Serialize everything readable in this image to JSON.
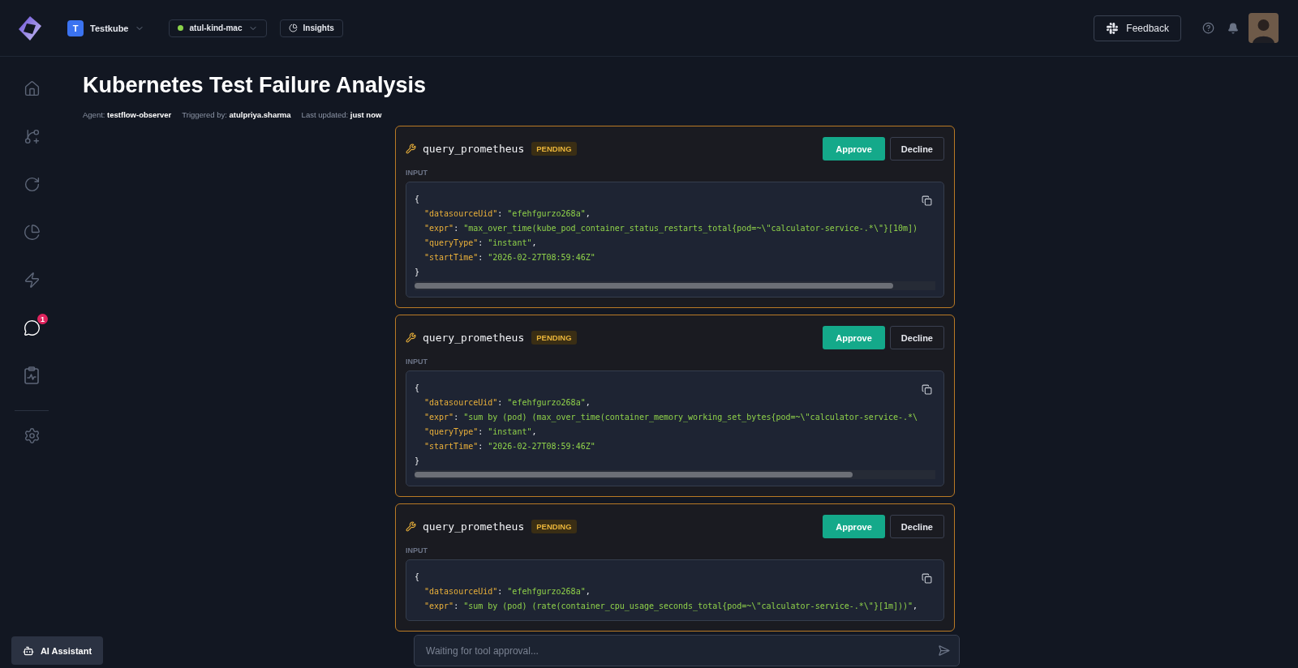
{
  "topbar": {
    "workspace": {
      "initial": "T",
      "name": "Testkube"
    },
    "environment": {
      "name": "atul-kind-mac",
      "color": "#8bd34a"
    },
    "insights": "Insights",
    "feedback": "Feedback"
  },
  "sidebar": {
    "items": [
      {
        "kind": "home",
        "selected": false
      },
      {
        "kind": "workflows",
        "selected": false
      },
      {
        "kind": "runs",
        "selected": false
      },
      {
        "kind": "analytics",
        "selected": false
      },
      {
        "kind": "triggers",
        "selected": false
      },
      {
        "kind": "chats",
        "selected": true,
        "badge": "1"
      },
      {
        "kind": "reports",
        "selected": false
      }
    ],
    "footer_items": [
      {
        "kind": "settings",
        "selected": false
      }
    ],
    "assistant": "AI Assistant"
  },
  "page": {
    "title": "Kubernetes Test Failure Analysis",
    "meta": [
      {
        "label": "Agent:",
        "value": "testflow-observer"
      },
      {
        "label": "Triggered by:",
        "value": "atulpriya.sharma"
      },
      {
        "label": "Last updated:",
        "value": "just now"
      }
    ]
  },
  "tool_calls": [
    {
      "name": "query_prometheus",
      "status": "PENDING",
      "approve": "Approve",
      "decline": "Decline",
      "input_label": "INPUT",
      "open": "{",
      "close": "}",
      "fields": [
        {
          "key": "\"datasourceUid\"",
          "sep": ":",
          "value": "\"efehfgurzo268a\"",
          "end": ","
        },
        {
          "key": "\"expr\"",
          "sep": ":",
          "value": "\"max_over_time(kube_pod_container_status_restarts_total{pod=~\\\"calculator-service-.*\\\"}[10m])"
        },
        {
          "key": "\"queryType\"",
          "sep": ":",
          "value": "\"instant\"",
          "end": ","
        },
        {
          "key": "\"startTime\"",
          "sep": ":",
          "value": "\"2026-02-27T08:59:46Z\""
        }
      ]
    },
    {
      "name": "query_prometheus",
      "status": "PENDING",
      "approve": "Approve",
      "decline": "Decline",
      "input_label": "INPUT",
      "open": "{",
      "close": "}",
      "fields": [
        {
          "key": "\"datasourceUid\"",
          "sep": ":",
          "value": "\"efehfgurzo268a\"",
          "end": ","
        },
        {
          "key": "\"expr\"",
          "sep": ":",
          "value": "\"sum by (pod) (max_over_time(container_memory_working_set_bytes{pod=~\\\"calculator-service-.*\\"
        },
        {
          "key": "\"queryType\"",
          "sep": ":",
          "value": "\"instant\"",
          "end": ","
        },
        {
          "key": "\"startTime\"",
          "sep": ":",
          "value": "\"2026-02-27T08:59:46Z\""
        }
      ]
    },
    {
      "name": "query_prometheus",
      "status": "PENDING",
      "approve": "Approve",
      "decline": "Decline",
      "input_label": "INPUT",
      "open": "{",
      "fields": [
        {
          "key": "\"datasourceUid\"",
          "sep": ":",
          "value": "\"efehfgurzo268a\"",
          "end": ","
        },
        {
          "key": "\"expr\"",
          "sep": ":",
          "value": "\"sum by (pod) (rate(container_cpu_usage_seconds_total{pod=~\\\"calculator-service-.*\\\"}[1m]))\"",
          "end": ","
        }
      ]
    }
  ],
  "chat_input": {
    "placeholder": "Waiting for tool approval..."
  }
}
